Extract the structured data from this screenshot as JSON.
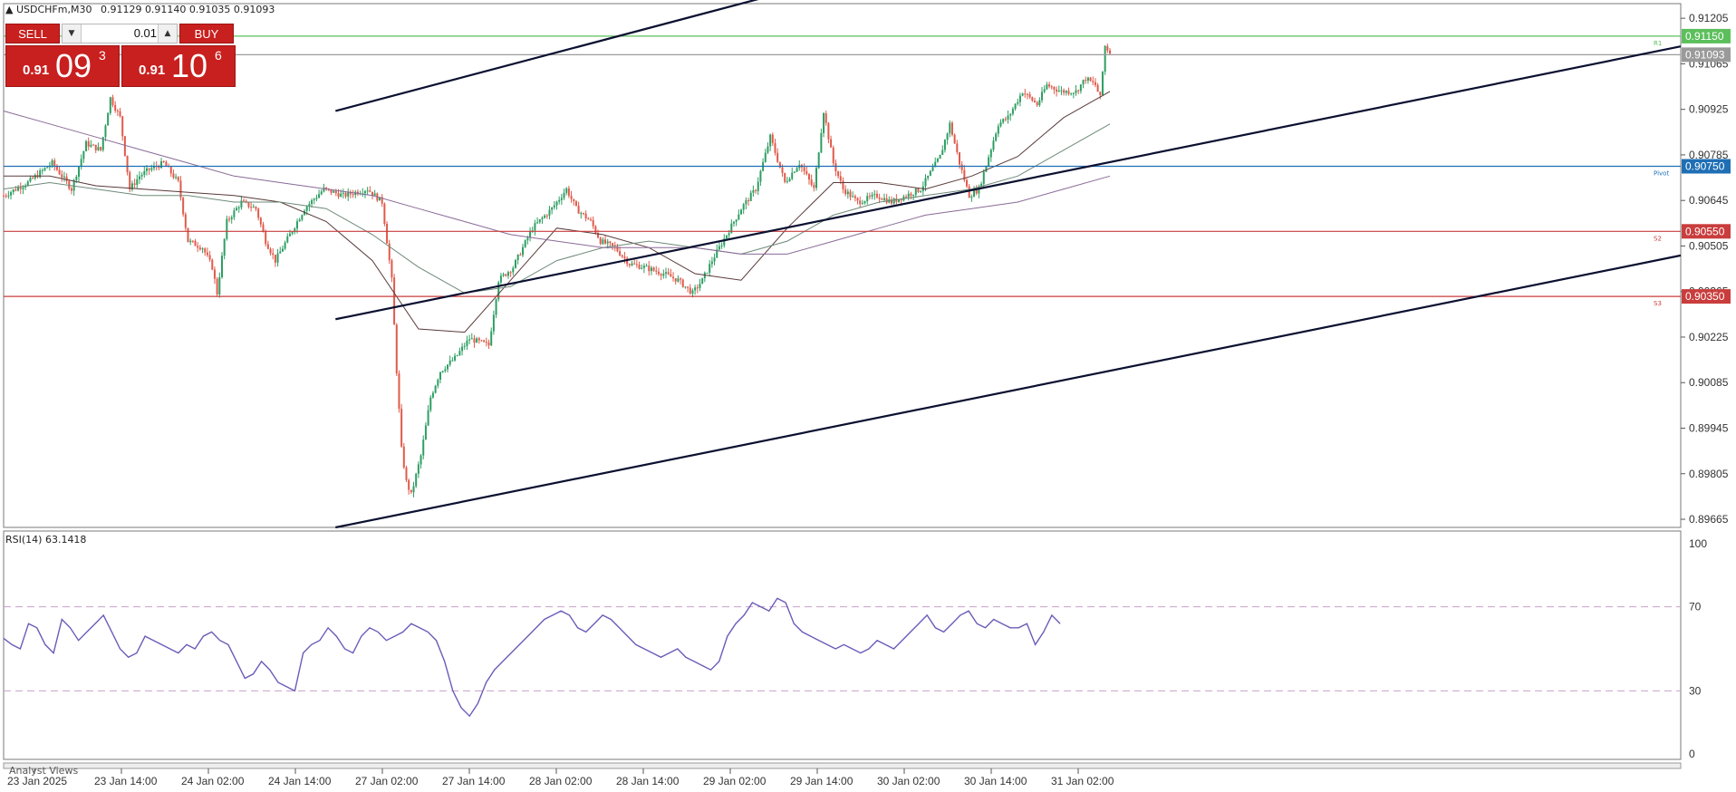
{
  "header": {
    "symbol": "USDCHFm,M30",
    "ohlc": "0.91129 0.91140 0.91035 0.91093"
  },
  "trade_panel": {
    "sell_label": "SELL",
    "buy_label": "BUY",
    "lot": "0.01",
    "sell_price": {
      "small": "0.91",
      "big": "09",
      "sup": "3"
    },
    "buy_price": {
      "small": "0.91",
      "big": "10",
      "sup": "6"
    }
  },
  "rsi_panel": {
    "label": "RSI(14) 63.1418"
  },
  "bottom_panel": {
    "label": "Analyst Views"
  },
  "colors": {
    "candle_up": "#2e9e63",
    "candle_down": "#e05a4a",
    "channel": "#0b1030",
    "r1": "#5cbf5c",
    "pivot": "#1f6fb5",
    "support": "#c93d3d",
    "rsi": "#6b5cb8"
  },
  "chart_data": [
    {
      "type": "candlestick",
      "price_ticks": [
        "0.91205",
        "0.91065",
        "0.90925",
        "0.90785",
        "0.90645",
        "0.90505",
        "0.90365",
        "0.90225",
        "0.90085",
        "0.89945",
        "0.89805",
        "0.89665"
      ],
      "ylim": [
        0.8964,
        0.9125
      ],
      "x_ticks": [
        "23 Jan 2025",
        "23 Jan 14:00",
        "24 Jan 02:00",
        "24 Jan 14:00",
        "27 Jan 02:00",
        "27 Jan 14:00",
        "28 Jan 02:00",
        "28 Jan 14:00",
        "29 Jan 02:00",
        "29 Jan 14:00",
        "30 Jan 02:00",
        "30 Jan 14:00",
        "31 Jan 02:00"
      ],
      "levels": [
        {
          "label": "0.91150",
          "value": 0.9115,
          "name": "R1",
          "color": "#5cbf5c"
        },
        {
          "label": "0.91093",
          "value": 0.91093,
          "name": "",
          "color": "#9a9a9a"
        },
        {
          "label": "0.90750",
          "value": 0.9075,
          "name": "Pivot",
          "color": "#1f6fb5"
        },
        {
          "label": "0.90550",
          "value": 0.9055,
          "name": "S2",
          "color": "#c93d3d"
        },
        {
          "label": "0.90350",
          "value": 0.9035,
          "name": "S3",
          "color": "#c93d3d"
        }
      ],
      "close_path": [
        [
          0,
          0.9066
        ],
        [
          10,
          0.907
        ],
        [
          20,
          0.9076
        ],
        [
          28,
          0.9068
        ],
        [
          34,
          0.9082
        ],
        [
          40,
          0.908
        ],
        [
          44,
          0.9096
        ],
        [
          48,
          0.909
        ],
        [
          52,
          0.9068
        ],
        [
          56,
          0.9072
        ],
        [
          60,
          0.9074
        ],
        [
          66,
          0.9076
        ],
        [
          72,
          0.907
        ],
        [
          76,
          0.9052
        ],
        [
          82,
          0.905
        ],
        [
          86,
          0.9044
        ],
        [
          88,
          0.9036
        ],
        [
          92,
          0.9058
        ],
        [
          98,
          0.9064
        ],
        [
          104,
          0.9062
        ],
        [
          108,
          0.9052
        ],
        [
          112,
          0.9046
        ],
        [
          118,
          0.9054
        ],
        [
          124,
          0.9062
        ],
        [
          132,
          0.9068
        ],
        [
          140,
          0.9066
        ],
        [
          150,
          0.9068
        ],
        [
          156,
          0.9064
        ],
        [
          160,
          0.904
        ],
        [
          162,
          0.9012
        ],
        [
          164,
          0.8988
        ],
        [
          166,
          0.8978
        ],
        [
          168,
          0.8974
        ],
        [
          172,
          0.8986
        ],
        [
          176,
          0.9004
        ],
        [
          180,
          0.9012
        ],
        [
          186,
          0.9016
        ],
        [
          192,
          0.9022
        ],
        [
          200,
          0.902
        ],
        [
          204,
          0.904
        ],
        [
          210,
          0.9044
        ],
        [
          218,
          0.9056
        ],
        [
          226,
          0.9062
        ],
        [
          232,
          0.9068
        ],
        [
          236,
          0.9062
        ],
        [
          242,
          0.9058
        ],
        [
          246,
          0.9052
        ],
        [
          252,
          0.905
        ],
        [
          258,
          0.9045
        ],
        [
          264,
          0.9044
        ],
        [
          272,
          0.9042
        ],
        [
          278,
          0.904
        ],
        [
          284,
          0.9036
        ],
        [
          288,
          0.904
        ],
        [
          292,
          0.9046
        ],
        [
          298,
          0.9054
        ],
        [
          304,
          0.9062
        ],
        [
          310,
          0.9068
        ],
        [
          316,
          0.9084
        ],
        [
          322,
          0.907
        ],
        [
          328,
          0.9076
        ],
        [
          334,
          0.9068
        ],
        [
          338,
          0.9092
        ],
        [
          342,
          0.9076
        ],
        [
          346,
          0.9068
        ],
        [
          352,
          0.9064
        ],
        [
          360,
          0.9066
        ],
        [
          366,
          0.9064
        ],
        [
          372,
          0.9066
        ],
        [
          378,
          0.9068
        ],
        [
          386,
          0.9078
        ],
        [
          390,
          0.9088
        ],
        [
          394,
          0.9076
        ],
        [
          398,
          0.9066
        ],
        [
          402,
          0.9068
        ],
        [
          406,
          0.9078
        ],
        [
          410,
          0.9088
        ],
        [
          414,
          0.909
        ],
        [
          420,
          0.9098
        ],
        [
          426,
          0.9094
        ],
        [
          430,
          0.91
        ],
        [
          436,
          0.9098
        ],
        [
          442,
          0.9098
        ],
        [
          446,
          0.9102
        ],
        [
          450,
          0.91
        ],
        [
          452,
          0.9096
        ],
        [
          454,
          0.9112
        ],
        [
          456,
          0.911
        ]
      ],
      "moving_averages": [
        {
          "color": "#5a3a3a",
          "values": [
            0.9072,
            0.9072,
            0.9069,
            0.9068,
            0.9067,
            0.9066,
            0.9064,
            0.9058,
            0.9046,
            0.9025,
            0.9024,
            0.904,
            0.9056,
            0.9054,
            0.905,
            0.9042,
            0.904,
            0.9056,
            0.907,
            0.907,
            0.9068,
            0.9072,
            0.9078,
            0.909,
            0.9098
          ]
        },
        {
          "color": "#6d8a78",
          "values": [
            0.9068,
            0.907,
            0.9068,
            0.9066,
            0.9066,
            0.9064,
            0.9064,
            0.9062,
            0.9054,
            0.9044,
            0.9036,
            0.9038,
            0.9046,
            0.905,
            0.9052,
            0.905,
            0.9048,
            0.9052,
            0.906,
            0.9064,
            0.9066,
            0.9068,
            0.9072,
            0.908,
            0.9088
          ]
        },
        {
          "color": "#8a6a98",
          "values": [
            0.9092,
            0.9088,
            0.9084,
            0.908,
            0.9076,
            0.9072,
            0.907,
            0.9068,
            0.9066,
            0.9062,
            0.9058,
            0.9054,
            0.9052,
            0.905,
            0.905,
            0.905,
            0.9048,
            0.9048,
            0.9052,
            0.9056,
            0.906,
            0.9062,
            0.9064,
            0.9068,
            0.9072
          ]
        }
      ],
      "channel_lines": [
        {
          "start": [
            0.3,
            0.9092
          ],
          "end": [
            0.7,
            0.9128
          ]
        },
        {
          "start": [
            0.3,
            0.9028
          ],
          "end": [
            1.75,
            0.9128
          ]
        },
        {
          "start": [
            0.3,
            0.8964
          ],
          "end": [
            1.9,
            0.9074
          ]
        }
      ]
    },
    {
      "type": "line",
      "title": "RSI(14) 63.1418",
      "y_ticks": [
        "100",
        "70",
        "30",
        "0"
      ],
      "ylim": [
        0,
        100
      ],
      "levels": [
        70,
        30
      ],
      "values": [
        55,
        52,
        50,
        62,
        60,
        52,
        48,
        64,
        60,
        54,
        58,
        62,
        66,
        58,
        50,
        46,
        48,
        56,
        54,
        52,
        50,
        48,
        52,
        50,
        56,
        58,
        54,
        52,
        44,
        36,
        38,
        44,
        40,
        34,
        32,
        30,
        48,
        52,
        54,
        60,
        56,
        50,
        48,
        56,
        60,
        58,
        54,
        56,
        58,
        62,
        60,
        58,
        54,
        44,
        30,
        22,
        18,
        24,
        34,
        40,
        44,
        48,
        52,
        56,
        60,
        64,
        66,
        68,
        66,
        60,
        58,
        62,
        66,
        64,
        60,
        56,
        52,
        50,
        48,
        46,
        48,
        50,
        46,
        44,
        42,
        40,
        44,
        56,
        62,
        66,
        72,
        70,
        68,
        74,
        72,
        62,
        58,
        56,
        54,
        52,
        50,
        52,
        50,
        48,
        50,
        54,
        52,
        50,
        54,
        58,
        62,
        66,
        60,
        58,
        62,
        66,
        68,
        62,
        60,
        64,
        62,
        60,
        60,
        62,
        52,
        58,
        66,
        62
      ],
      "rsi_start_fraction": 0.0,
      "rsi_end_fraction": 0.63
    }
  ]
}
